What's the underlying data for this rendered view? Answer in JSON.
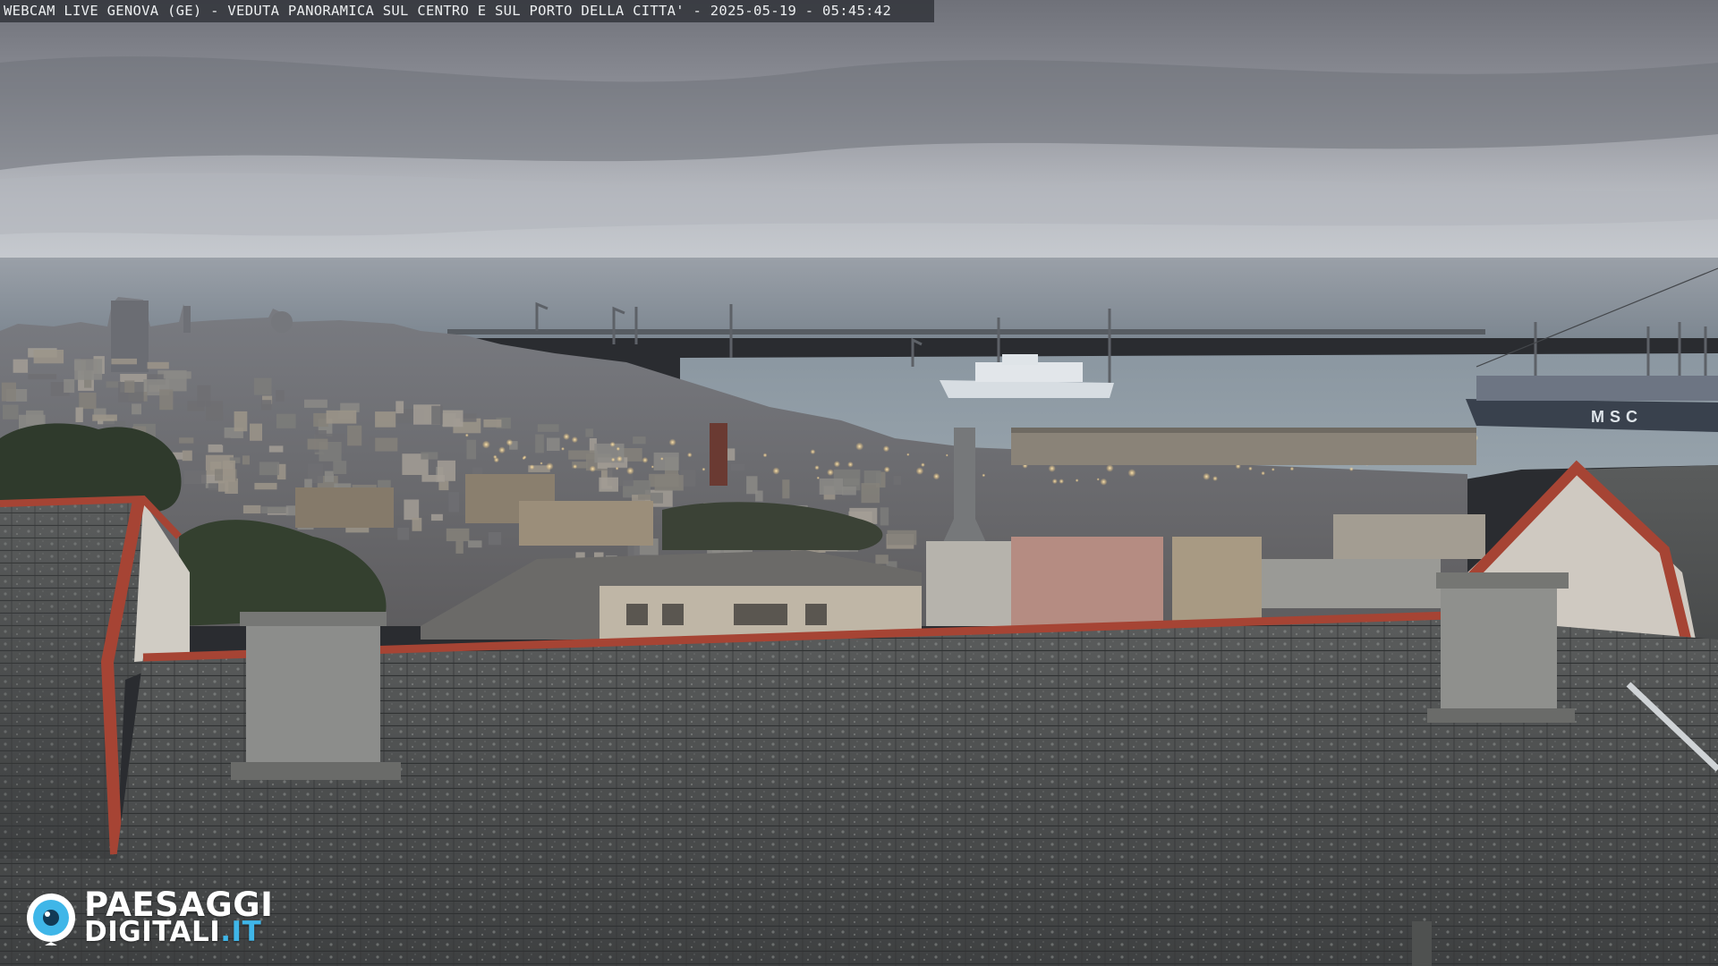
{
  "overlay": {
    "caption": "WEBCAM LIVE GENOVA (GE) - VEDUTA PANORAMICA SUL CENTRO E SUL PORTO DELLA CITTA' - 2025-05-19 - 05:45:42"
  },
  "ship": {
    "hull_text": "MSC"
  },
  "logo": {
    "line1": "PAESAGGI",
    "line2_main": "DIGITALI",
    "line2_tld": ".IT",
    "icon": "camera-eye-icon"
  },
  "colors": {
    "sky_top": "#7e8088",
    "sky_bottom": "#c9ccd1",
    "sea": "#8a949d",
    "roof": "#4a4c4c",
    "roof_trim": "#a9473a",
    "logo_accent": "#3fb6e8"
  }
}
